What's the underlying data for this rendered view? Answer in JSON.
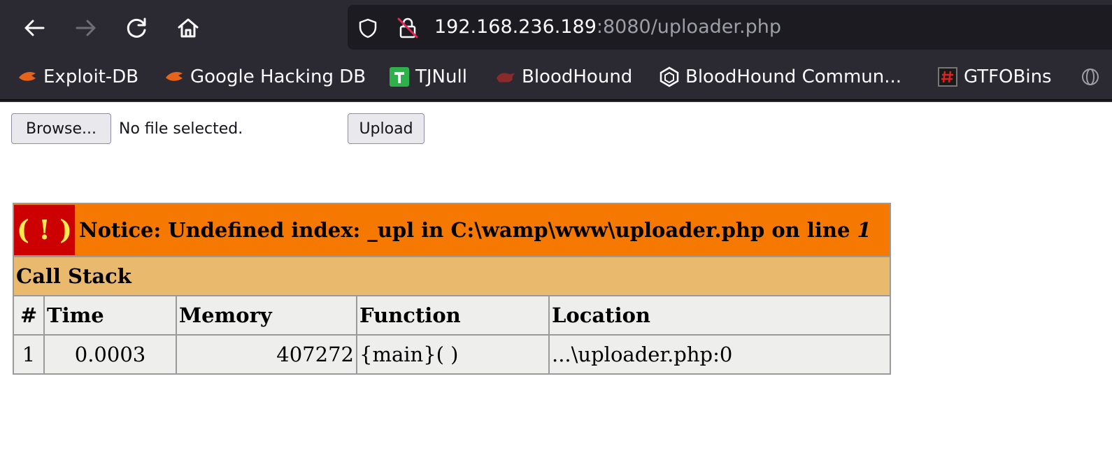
{
  "browser": {
    "url_host": "192.168.236.189",
    "url_rest": ":8080/uploader.php",
    "bookmarks": [
      {
        "label": "Exploit-DB",
        "icon": "exploit-db-icon"
      },
      {
        "label": "Google Hacking DB",
        "icon": "exploit-db-icon"
      },
      {
        "label": "TJNull",
        "icon": "tjnull-icon"
      },
      {
        "label": "BloodHound",
        "icon": "bloodhound-icon"
      },
      {
        "label": "BloodHound Commun...",
        "icon": "bloodhound-community-icon"
      },
      {
        "label": "GTFOBins",
        "icon": "gtfobins-icon"
      }
    ]
  },
  "form": {
    "browse_label": "Browse...",
    "file_status": "No file selected.",
    "upload_label": "Upload"
  },
  "error": {
    "badge": "( ! )",
    "notice": "Notice: Undefined index: _upl in C:\\wamp\\www\\uploader.php on line ",
    "line": "1",
    "call_stack": "Call Stack",
    "columns": [
      "#",
      "Time",
      "Memory",
      "Function",
      "Location"
    ],
    "rows": [
      {
        "num": "1",
        "time": "0.0003",
        "memory": "407272",
        "function": "{main}( )",
        "location": "...\\uploader.php:0"
      }
    ]
  },
  "colors": {
    "notice_bg": "#f57900",
    "badge_bg": "#cc0000",
    "badge_fg": "#fce94f",
    "callstack_bg": "#e9b96e",
    "table_bg": "#eeeeec",
    "chrome_bg": "#2b2a33"
  }
}
